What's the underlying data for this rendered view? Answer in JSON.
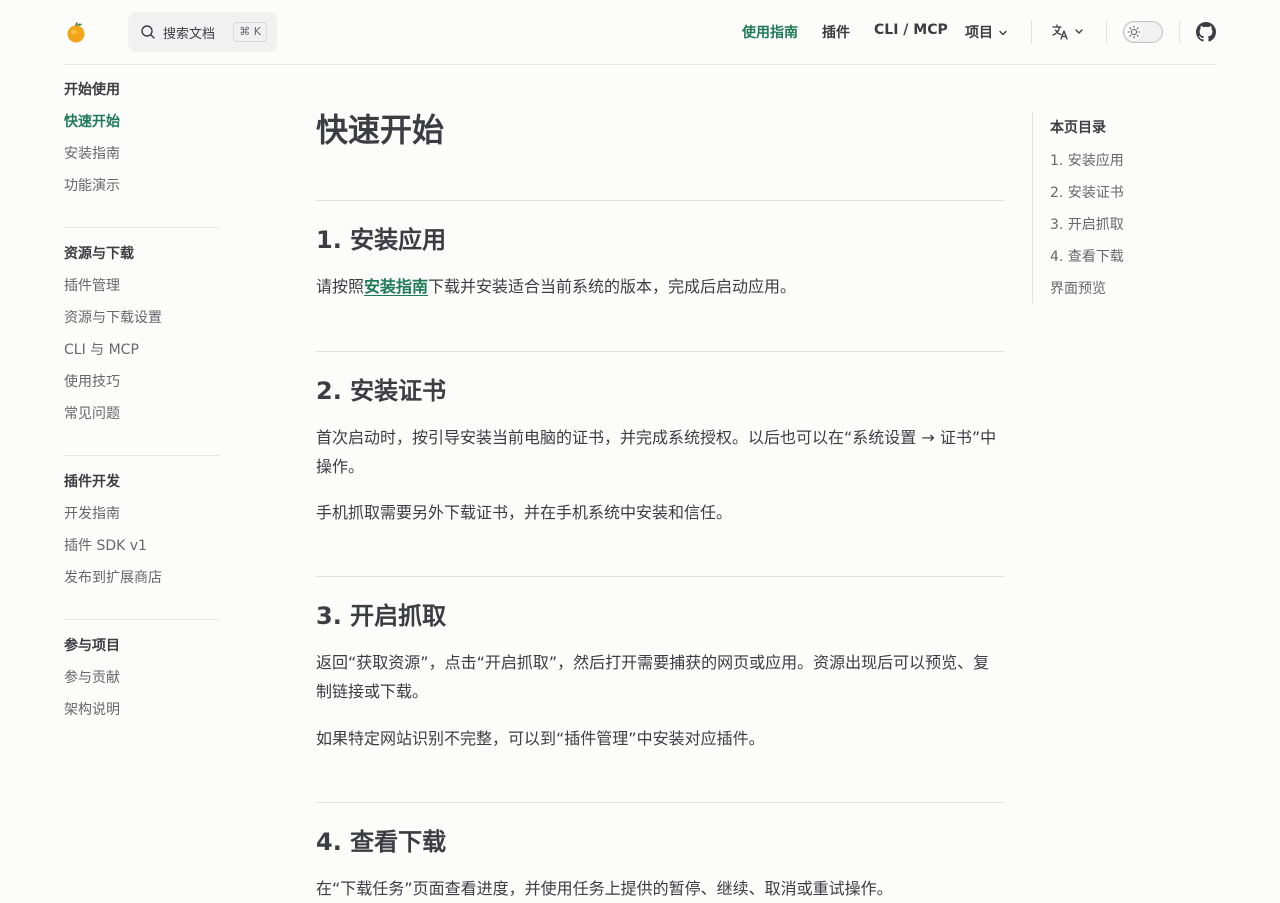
{
  "header": {
    "search": {
      "label": "搜索文档",
      "shortcut": "⌘ K"
    },
    "nav": {
      "guide": "使用指南",
      "plugins": "插件",
      "cli": "CLI / MCP",
      "project": "项目"
    }
  },
  "sidebar": {
    "groups": [
      {
        "title": "开始使用",
        "items": [
          "快速开始",
          "安装指南",
          "功能演示"
        ]
      },
      {
        "title": "资源与下载",
        "items": [
          "插件管理",
          "资源与下载设置",
          "CLI 与 MCP",
          "使用技巧",
          "常见问题"
        ]
      },
      {
        "title": "插件开发",
        "items": [
          "开发指南",
          "插件 SDK v1",
          "发布到扩展商店"
        ]
      },
      {
        "title": "参与项目",
        "items": [
          "参与贡献",
          "架构说明"
        ]
      }
    ]
  },
  "main": {
    "title": "快速开始",
    "sections": [
      {
        "heading": "1. 安装应用",
        "p1_before": "请按照",
        "p1_link": "安装指南",
        "p1_after": "下载并安装适合当前系统的版本，完成后启动应用。"
      },
      {
        "heading": "2. 安装证书",
        "p1": "首次启动时，按引导安装当前电脑的证书，并完成系统授权。以后也可以在“系统设置 → 证书”中操作。",
        "p2": "手机抓取需要另外下载证书，并在手机系统中安装和信任。"
      },
      {
        "heading": "3. 开启抓取",
        "p1": "返回“获取资源”，点击“开启抓取”，然后打开需要捕获的网页或应用。资源出现后可以预览、复制链接或下载。",
        "p2": "如果特定网站识别不完整，可以到“插件管理”中安装对应插件。"
      },
      {
        "heading": "4. 查看下载",
        "p1": "在“下载任务”页面查看进度，并使用任务上提供的暂停、继续、取消或重试操作。"
      }
    ]
  },
  "outline": {
    "title": "本页目录",
    "items": [
      "1. 安装应用",
      "2. 安装证书",
      "3. 开启抓取",
      "4. 查看下载",
      "界面预览"
    ]
  },
  "colors": {
    "brand": "#1f7a56",
    "text": "#3c3c43",
    "muted": "#67676c",
    "background": "#fcfcfb"
  },
  "icons": {
    "logo": "orange-fruit-icon",
    "search": "search-icon",
    "chevron": "chevron-down-icon",
    "language": "translate-icon",
    "theme": "sun-icon",
    "github": "github-icon"
  }
}
